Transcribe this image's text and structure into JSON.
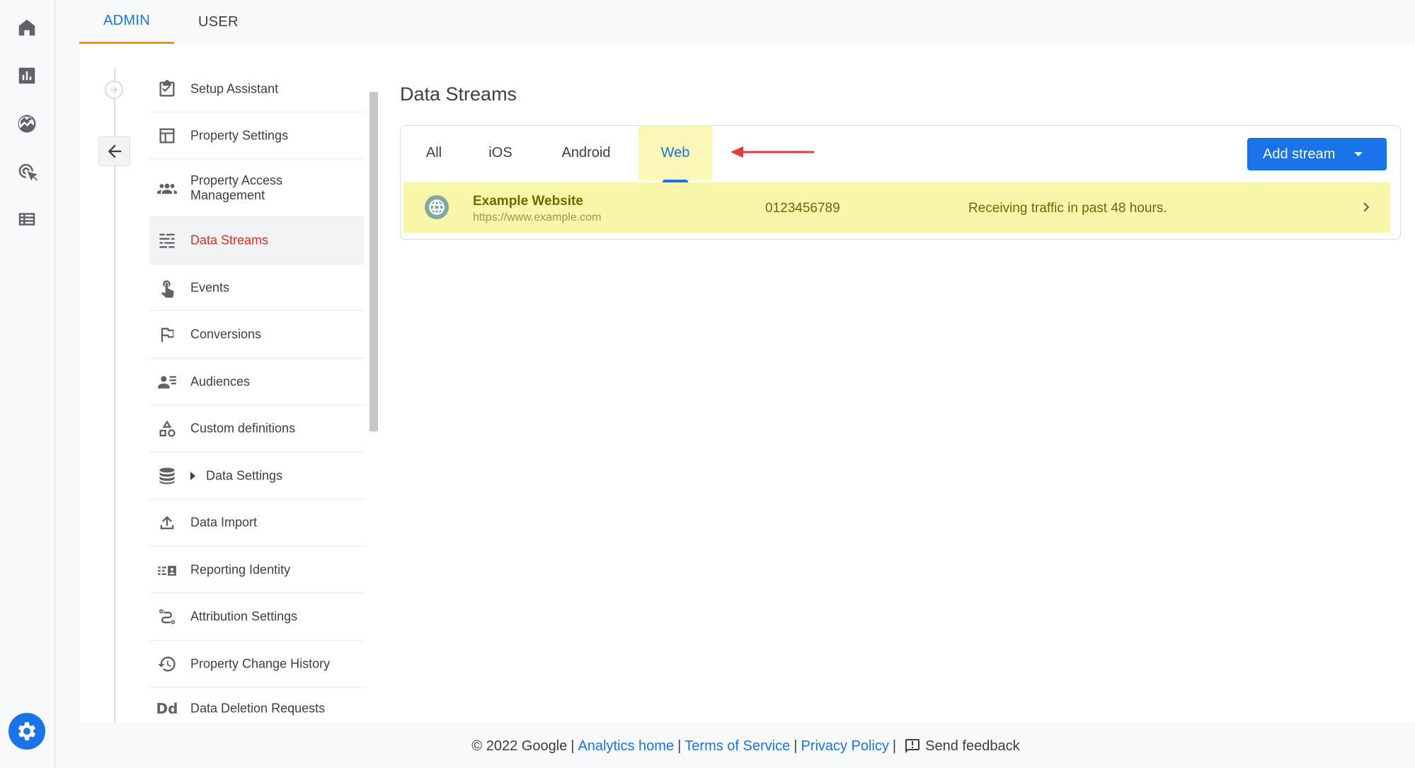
{
  "top_tabs": [
    {
      "label": "ADMIN",
      "active": true
    },
    {
      "label": "USER",
      "active": false
    }
  ],
  "nav": {
    "items": [
      {
        "label": "Setup Assistant",
        "icon": "checklist-icon"
      },
      {
        "label": "Property Settings",
        "icon": "layout-icon"
      },
      {
        "label": "Property Access Management",
        "icon": "people-icon"
      },
      {
        "label": "Data Streams",
        "icon": "streams-icon",
        "active": true
      },
      {
        "label": "Events",
        "icon": "touch-icon"
      },
      {
        "label": "Conversions",
        "icon": "flag-icon"
      },
      {
        "label": "Audiences",
        "icon": "audience-icon"
      },
      {
        "label": "Custom definitions",
        "icon": "shapes-icon"
      },
      {
        "label": "Data Settings",
        "icon": "database-icon",
        "expandable": true
      },
      {
        "label": "Data Import",
        "icon": "upload-icon"
      },
      {
        "label": "Reporting Identity",
        "icon": "identity-icon"
      },
      {
        "label": "Attribution Settings",
        "icon": "attribution-icon"
      },
      {
        "label": "Property Change History",
        "icon": "history-icon"
      },
      {
        "label": "Data Deletion Requests",
        "icon": "dd-icon",
        "icon_text": "Dd"
      }
    ]
  },
  "main": {
    "title": "Data Streams",
    "filter_tabs": [
      {
        "label": "All"
      },
      {
        "label": "iOS"
      },
      {
        "label": "Android"
      },
      {
        "label": "Web",
        "active": true
      }
    ],
    "add_stream_label": "Add stream",
    "streams": [
      {
        "name": "Example Website",
        "url": "https://www.example.com",
        "id": "0123456789",
        "status": "Receiving traffic in past 48 hours."
      }
    ]
  },
  "footer": {
    "copyright": "© 2022 Google",
    "analytics_home": "Analytics home",
    "terms": "Terms of Service",
    "privacy": "Privacy Policy",
    "feedback": "Send feedback",
    "separator": "|"
  },
  "colors": {
    "accent": "#1a73e8",
    "active_nav_text": "#d93025",
    "highlight": "#f8f6a8",
    "tab_underline": "#f29900",
    "arrow": "#e53935"
  }
}
